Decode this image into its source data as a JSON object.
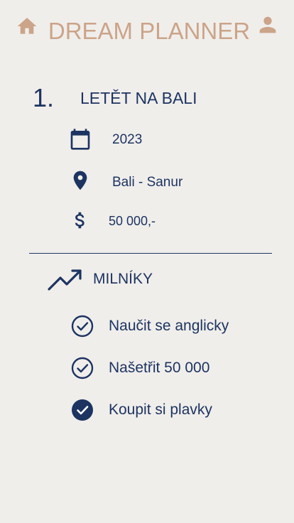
{
  "header": {
    "title": "DREAM PLANNER",
    "home_icon": "home-icon",
    "user_icon": "user-icon",
    "accent_color": "#cba489"
  },
  "goal": {
    "number": "1.",
    "title": "LETĚT NA BALI",
    "year": "2023",
    "location": "Bali - Sanur",
    "budget": "50 000,-"
  },
  "milestones": {
    "heading": "MILNÍKY",
    "icon": "trending-up-icon",
    "items": [
      {
        "label": "Naučit se anglicky",
        "done": false
      },
      {
        "label": "Našetřit 50 000",
        "done": false
      },
      {
        "label": "Koupit si plavky",
        "done": true
      }
    ]
  },
  "colors": {
    "background": "#f0eeeb",
    "primary": "#1d3461"
  }
}
